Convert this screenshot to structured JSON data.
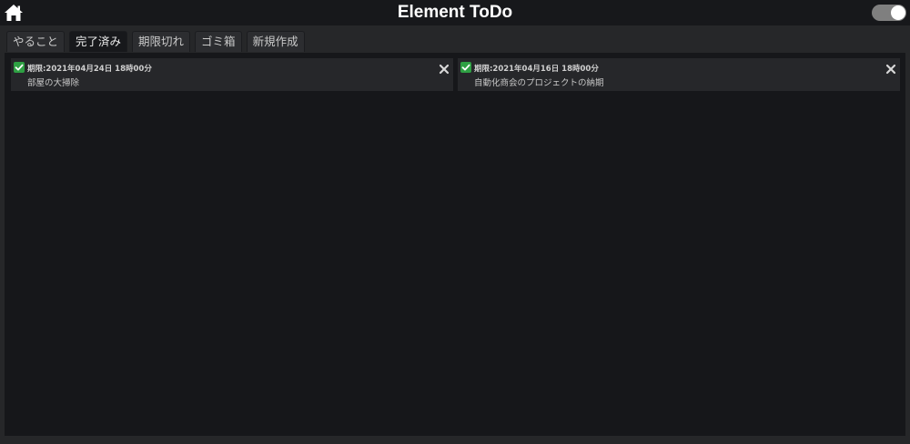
{
  "app": {
    "title": "Element ToDo",
    "icons": {
      "home": "home-icon",
      "toggle": "toggle-switch-icon"
    },
    "colors": {
      "accent_green": "#2ea043",
      "background": "#16171a",
      "titlebar": "#17181b"
    }
  },
  "tabs": [
    {
      "label": "やること",
      "active": false
    },
    {
      "label": "完了済み",
      "active": true
    },
    {
      "label": "期限切れ",
      "active": false
    },
    {
      "label": "ゴミ箱",
      "active": false
    },
    {
      "label": "新規作成",
      "active": false
    }
  ],
  "todos": [
    {
      "deadline": "期限:2021年04月24日 18時00分",
      "text": "部屋の大掃除",
      "done": true
    },
    {
      "deadline": "期限:2021年04月16日 18時00分",
      "text": "自動化商会のプロジェクトの納期",
      "done": true
    }
  ]
}
